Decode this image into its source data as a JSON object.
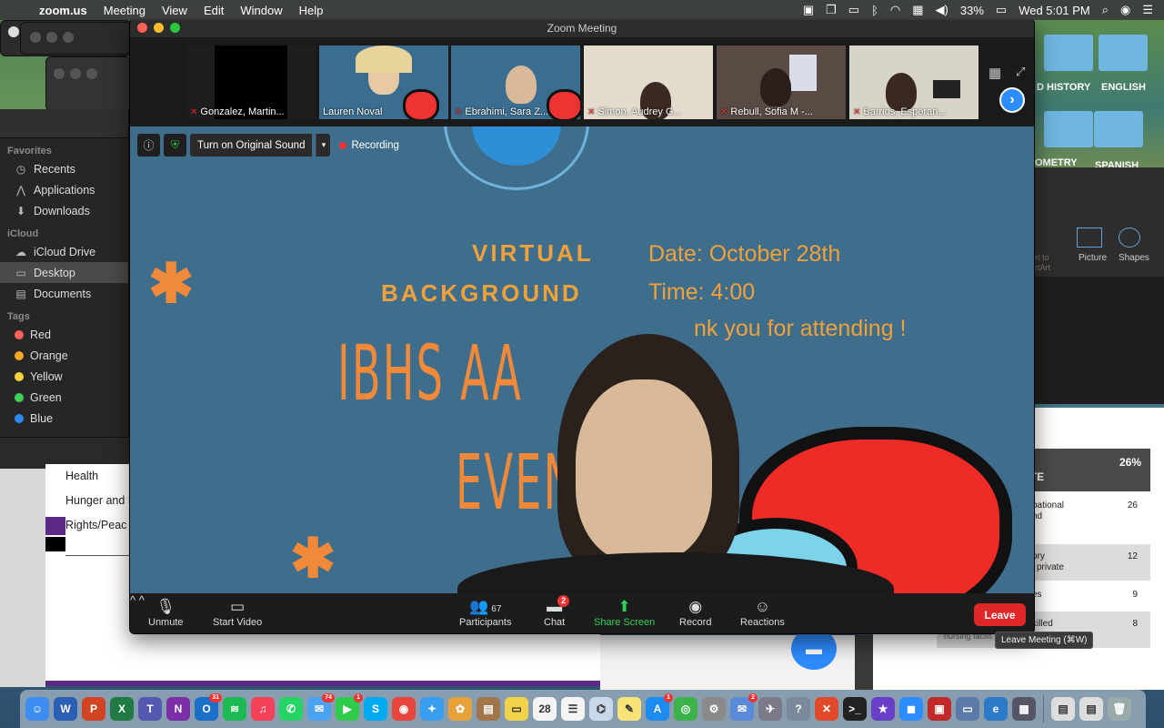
{
  "menubar": {
    "app": "zoom.us",
    "items": [
      "Meeting",
      "View",
      "Edit",
      "Window",
      "Help"
    ],
    "battery": "33%",
    "clock": "Wed 5:01 PM"
  },
  "finder": {
    "favorites_title": "Favorites",
    "favorites": [
      "Recents",
      "Applications",
      "Downloads"
    ],
    "icloud_title": "iCloud",
    "icloud": [
      "iCloud Drive",
      "Desktop",
      "Documents"
    ],
    "tags_title": "Tags",
    "tags": [
      {
        "label": "Red",
        "color": "#ff5f57"
      },
      {
        "label": "Orange",
        "color": "#f5a623"
      },
      {
        "label": "Yellow",
        "color": "#f8d33c"
      },
      {
        "label": "Green",
        "color": "#3fd05a"
      },
      {
        "label": "Blue",
        "color": "#2f86f6"
      }
    ]
  },
  "doc": {
    "lines": [
      "Health",
      "Hunger and I",
      "Rights/Peac"
    ]
  },
  "right": {
    "folders": [
      "D HISTORY",
      "ENGLISH",
      "OMETRY",
      "SPANISH"
    ],
    "ppt": [
      "Picture",
      "Shapes",
      "rt to",
      "rtArt"
    ],
    "table": {
      "header": [
        ",",
        "ATE",
        "26%"
      ],
      "rows": [
        {
          "text": "pational",
          "text2": "nd",
          "num": "26"
        },
        {
          "text": "ory",
          "text2": "private",
          "num": "12"
        },
        {
          "text": "es",
          "text2": "",
          "num": "9"
        },
        {
          "text": "killed",
          "text2": "nursing facilit",
          "num": "8"
        }
      ]
    }
  },
  "zoom": {
    "title": "Zoom Meeting",
    "participants": [
      {
        "name": "Gonzalez, Martin...",
        "muted": true
      },
      {
        "name": "Lauren Noval",
        "muted": false
      },
      {
        "name": "Ebrahimi, Sara Z...",
        "muted": true
      },
      {
        "name": "Simon, Audrey G...",
        "muted": true
      },
      {
        "name": "Rebull, Sofia M -...",
        "muted": true
      },
      {
        "name": "Barrios, Esperan...",
        "muted": true
      }
    ],
    "original_sound": "Turn on Original Sound",
    "recording": "Recording",
    "slide": {
      "vb1": "VIRTUAL",
      "vb2": "BACKGROUND",
      "date": "Date: October 28th",
      "time": "Time: 4:00",
      "thanks": "nk you for attending !",
      "big1": "IBHS AA",
      "big2": "EVEN"
    },
    "controls": {
      "unmute": "Unmute",
      "start_video": "Start Video",
      "participants": "Participants",
      "participants_count": "67",
      "chat": "Chat",
      "chat_badge": "2",
      "share": "Share Screen",
      "record": "Record",
      "reactions": "Reactions",
      "leave": "Leave"
    },
    "tooltip": "Leave Meeting (⌘W)"
  },
  "dock": {
    "icons": [
      {
        "name": "finder-icon",
        "label": "☺",
        "color": "#3d8ef0"
      },
      {
        "name": "word-icon",
        "label": "W",
        "color": "#2b5fb4"
      },
      {
        "name": "powerpoint-icon",
        "label": "P",
        "color": "#d04423"
      },
      {
        "name": "excel-icon",
        "label": "X",
        "color": "#1f7a44"
      },
      {
        "name": "teams-icon",
        "label": "T",
        "color": "#5558af"
      },
      {
        "name": "onenote-icon",
        "label": "N",
        "color": "#7b2fa8"
      },
      {
        "name": "outlook-icon",
        "label": "O",
        "color": "#1a6fc9",
        "badge": "31"
      },
      {
        "name": "spotify-icon",
        "label": "≋",
        "color": "#1db954"
      },
      {
        "name": "music-icon",
        "label": "♫",
        "color": "#f5425a"
      },
      {
        "name": "whatsapp-icon",
        "label": "✆",
        "color": "#25d366"
      },
      {
        "name": "messages-icon",
        "label": "✉",
        "color": "#4aa3f0",
        "badge": "74"
      },
      {
        "name": "facetime-icon",
        "label": "▶",
        "color": "#2ecc4a",
        "badge": "1"
      },
      {
        "name": "skype-icon",
        "label": "S",
        "color": "#00a9f0"
      },
      {
        "name": "chrome-icon",
        "label": "◉",
        "color": "#e8453c"
      },
      {
        "name": "safari-icon",
        "label": "✦",
        "color": "#3a9ef0"
      },
      {
        "name": "photos-icon",
        "label": "✿",
        "color": "#e8a23c"
      },
      {
        "name": "notes-book-icon",
        "label": "▤",
        "color": "#a0764a"
      },
      {
        "name": "stickies-icon",
        "label": "▭",
        "color": "#f1d24a"
      },
      {
        "name": "calendar-icon",
        "label": "28",
        "color": "#f4f4f4"
      },
      {
        "name": "reminders-icon",
        "label": "☰",
        "color": "#f4f4f4"
      },
      {
        "name": "preview-icon",
        "label": "⌬",
        "color": "#c8d8e8"
      },
      {
        "name": "notes-icon",
        "label": "✎",
        "color": "#f8e27a"
      },
      {
        "name": "appstore-icon",
        "label": "A",
        "color": "#1d8cf0",
        "badge": "1"
      },
      {
        "name": "maps-icon",
        "label": "◎",
        "color": "#3bb34a"
      },
      {
        "name": "settings-icon",
        "label": "⚙",
        "color": "#8a8a8a"
      },
      {
        "name": "preview2-icon",
        "label": "✉",
        "color": "#5a8ad8",
        "badge": "2"
      },
      {
        "name": "launchpad-icon",
        "label": "✈",
        "color": "#7a7a8a"
      },
      {
        "name": "help-icon",
        "label": "?",
        "color": "#7a8a9a"
      },
      {
        "name": "remote-icon",
        "label": "✕",
        "color": "#e04a2a"
      },
      {
        "name": "terminal-icon",
        "label": ">_",
        "color": "#222"
      },
      {
        "name": "imovie-icon",
        "label": "★",
        "color": "#6a3fc8"
      },
      {
        "name": "zoom-icon",
        "label": "◼",
        "color": "#2d8cff"
      },
      {
        "name": "photobooth-icon",
        "label": "▣",
        "color": "#c22a2a"
      },
      {
        "name": "display-icon",
        "label": "▭",
        "color": "#5a7aa8"
      },
      {
        "name": "edge-icon",
        "label": "e",
        "color": "#2a7ac8"
      },
      {
        "name": "downloads-icon",
        "label": "▦",
        "color": "#556"
      },
      {
        "name": "doc1-icon",
        "label": "▤",
        "color": "#ddd"
      },
      {
        "name": "doc2-icon",
        "label": "▤",
        "color": "#ddd"
      },
      {
        "name": "trash-icon",
        "label": "🗑",
        "color": "#9aa"
      }
    ]
  }
}
